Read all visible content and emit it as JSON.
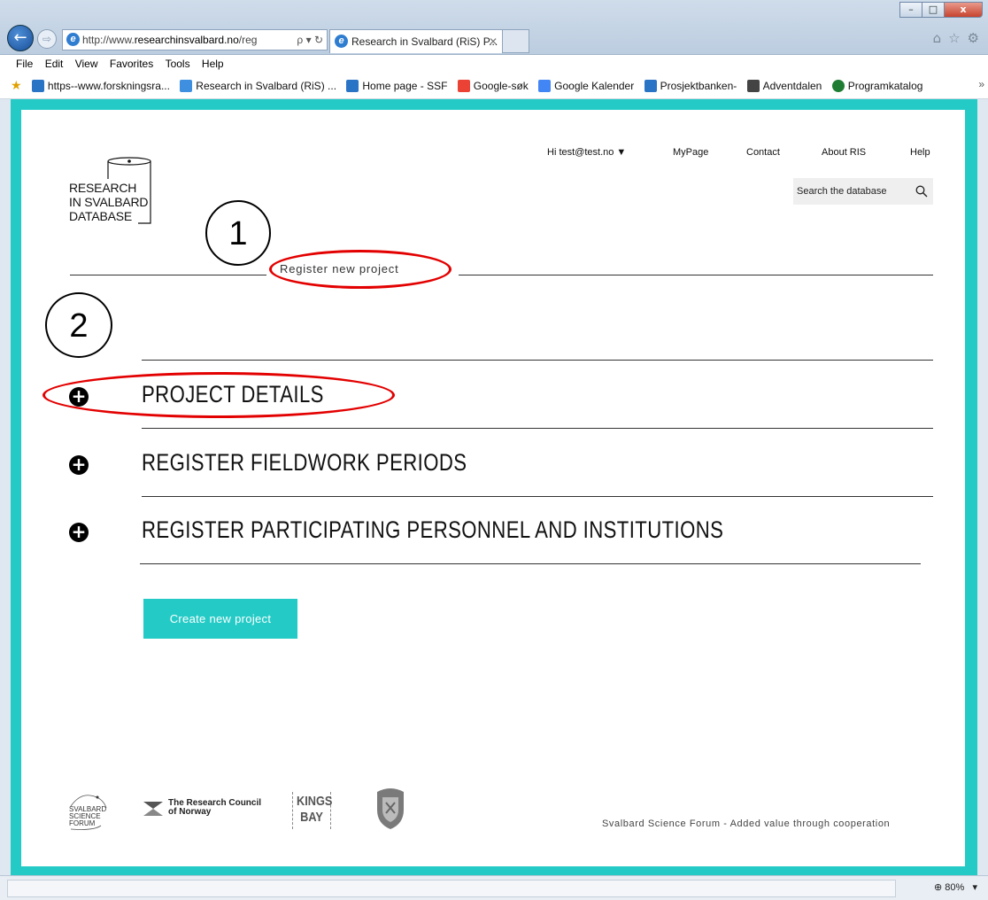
{
  "browser": {
    "address_url_prefix": "http://www.",
    "address_url_domain": "researchinsvalbard.no",
    "address_url_suffix": "/reg",
    "address_tools": "ρ ▾ ↻",
    "tab_title": "Research in Svalbard (RiS) P...",
    "tab_close": "✕",
    "win_minimize": "–",
    "win_maximize": "□",
    "win_close": "x",
    "back_icon": "←",
    "forward_icon": "⇨",
    "right_icons": [
      "⌂",
      "☆",
      "⚙"
    ],
    "menu": [
      "File",
      "Edit",
      "View",
      "Favorites",
      "Tools",
      "Help"
    ],
    "favorites": [
      {
        "label": "https--www.forskningsra...",
        "color": "#2a74c6"
      },
      {
        "label": "Research in Svalbard (RiS) ...",
        "color": "#3f8fe0"
      },
      {
        "label": "Home page - SSF",
        "color": "#2a74c6"
      },
      {
        "label": "Google-søk",
        "color": "#ea4335"
      },
      {
        "label": "Google Kalender",
        "color": "#4285f4"
      },
      {
        "label": "Prosjektbanken-",
        "color": "#2a74c6"
      },
      {
        "label": "Adventdalen",
        "color": "#444444"
      },
      {
        "label": "Programkatalog",
        "color": "#1e7d32"
      }
    ],
    "fav_more": "»",
    "zoom": "80%",
    "zoom_icon": "⊕"
  },
  "header": {
    "logo_text": "RESEARCH\nIN SVALBARD\nDATABASE",
    "nav": {
      "user": "Hi test@test.no ▼",
      "mypage": "MyPage",
      "contact": "Contact",
      "about": "About RIS",
      "help": "Help"
    },
    "search_placeholder": "Search the database"
  },
  "annotations": {
    "one": "1",
    "two": "2"
  },
  "main": {
    "section_title": "Register new project",
    "accordion": [
      {
        "label": "PROJECT DETAILS",
        "icon": "+"
      },
      {
        "label": "REGISTER FIELDWORK PERIODS",
        "icon": "+"
      },
      {
        "label": "REGISTER PARTICIPATING PERSONNEL AND INSTITUTIONS",
        "icon": "+"
      }
    ],
    "create_button": "Create new project"
  },
  "footer": {
    "ssf_logo_text": "SVALBARD\nSCIENCE\nFORUM",
    "rcn_logo_text": "The Research Council\nof Norway",
    "kings_bay_text": "KINGS\nBAY",
    "tagline": "Svalbard Science Forum - Added value through cooperation"
  },
  "colors": {
    "accent": "#24cbc6",
    "annotation_red": "#e30000"
  }
}
